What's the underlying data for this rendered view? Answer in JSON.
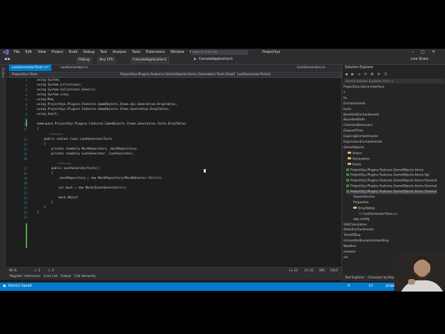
{
  "menu": [
    "File",
    "Edit",
    "View",
    "Project",
    "Build",
    "Debug",
    "Test",
    "Analyze",
    "Tools",
    "Extensions",
    "Window",
    "Help"
  ],
  "search_placeholder": "Search (Ctrl+Q)",
  "solution_name": "ProjectXyz",
  "toolbar": {
    "config": "Debug",
    "platform": "Any CPU",
    "startup": "ConsoleApplication1",
    "run": "ConsoleApplication1",
    "live_share": "Live Share"
  },
  "left_strip_label": "Toolbox",
  "tabs": [
    {
      "label": "LootGeneratorTests.cs*",
      "active": true
    },
    {
      "label": "LootGenerator.cs",
      "active": false
    },
    {
      "label": "ILootGenerator.cs",
      "active": false
    }
  ],
  "navbar": {
    "project": "ProjectXyz.Tests",
    "class": "ProjectXyz.Plugins.Features.GameObjects.Items.Generation.Tests.DropTables",
    "member": "LootGeneratorTests()"
  },
  "code_lines": [
    {
      "n": "1",
      "t": "using System;"
    },
    {
      "n": "2",
      "t": "using System.Collections;"
    },
    {
      "n": "3",
      "t": "using System.Collections.Generic;"
    },
    {
      "n": "4",
      "t": "using System.Linq;"
    },
    {
      "n": "5",
      "t": "using Moq;"
    },
    {
      "n": "6",
      "t": "using ProjectXyz.Plugins.Features.GameObjects.Items.Api.Generation.DropTables;"
    },
    {
      "n": "7",
      "t": "using ProjectXyz.Plugins.Features.GameObjects.Items.Generation.DropTables;"
    },
    {
      "n": "8",
      "t": "using Xunit;"
    },
    {
      "n": "9",
      "t": ""
    },
    {
      "n": "10",
      "t": "namespace ProjectXyz.Plugins.Features.GameObjects.Items.Generation.Tests.DropTables"
    },
    {
      "n": "11",
      "t": "{"
    },
    {
      "n": "12",
      "t": "    public sealed class LootGeneratorTests"
    },
    {
      "n": "13",
      "t": "    {"
    },
    {
      "n": "14",
      "t": "        private readonly MockRepository _mockRepository;"
    },
    {
      "n": "15",
      "t": "        private readonly LootGenerator _lootGenerator;"
    },
    {
      "n": "16",
      "t": ""
    },
    {
      "n": "17",
      "t": "        public LootGeneratorTests()"
    },
    {
      "n": "18",
      "t": "        {"
    },
    {
      "n": "19",
      "t": "            _mockRepository = new MockRepository(MockBehavior.Strict);"
    },
    {
      "n": "20",
      "t": ""
    },
    {
      "n": "21",
      "t": "            var mock = new Mock<ILootGenerator>();"
    },
    {
      "n": "22",
      "t": ""
    },
    {
      "n": "23",
      "t": "            mock.Object"
    },
    {
      "n": "24",
      "t": "        }"
    },
    {
      "n": "25",
      "t": "    }"
    },
    {
      "n": "26",
      "t": "}"
    },
    {
      "n": "27",
      "t": ""
    }
  ],
  "hints": {
    "class_refs": "0 references",
    "ctor_refs": "0 references"
  },
  "editor_status": {
    "zoom": "99 %",
    "errors": "2",
    "warnings": "0",
    "ln": "Ln 23",
    "ch": "Ch 25",
    "spc": "SPC",
    "crlf": "CRLF"
  },
  "bottom_tabs": [
    "'Register' references",
    "Error List",
    "Output",
    "Call Hierarchy"
  ],
  "statusbar": {
    "message": "Item(s) Saved",
    "up": "0",
    "changes": "13",
    "branch": "proje"
  },
  "solution_explorer": {
    "title": "Solution Explorer",
    "search": "Search Solution Explorer (Ctrl+;)",
    "items": [
      {
        "label": "ProjectXyz.Game.Interface",
        "kind": "text"
      },
      {
        "label": "s",
        "kind": "text"
      },
      {
        "label": "ta",
        "kind": "text"
      },
      {
        "label": "Enchantments",
        "kind": "text"
      },
      {
        "label": "tures",
        "kind": "text"
      },
      {
        "label": "BaseStatEnchantments",
        "kind": "text"
      },
      {
        "label": "BoundedStats",
        "kind": "text"
      },
      {
        "label": "CommonBehaviors",
        "kind": "text"
      },
      {
        "label": "ElapsedTime",
        "kind": "text"
      },
      {
        "label": "ExpiringEnchantments",
        "kind": "text"
      },
      {
        "label": "ExpressionEnchantments",
        "kind": "text"
      },
      {
        "label": "GameObjects",
        "kind": "text"
      },
      {
        "label": "Actors",
        "kind": "folder"
      },
      {
        "label": "Generation",
        "kind": "folder"
      },
      {
        "label": "Items",
        "kind": "folder"
      },
      {
        "label": "ProjectXyz.Plugins.Features.GameObjects.Items",
        "kind": "proj"
      },
      {
        "label": "ProjectXyz.Plugins.Features.GameObjects.Items.Api",
        "kind": "proj"
      },
      {
        "label": "ProjectXyz.Plugins.Features.GameObjects.Items.Generat",
        "kind": "proj"
      },
      {
        "label": "ProjectXyz.Plugins.Features.GameObjects.Items.Generat",
        "kind": "proj"
      },
      {
        "label": "ProjectXyz.Plugins.Features.GameObjects.Items.Generat",
        "kind": "proj"
      },
      {
        "label": "Dependencies",
        "kind": "sub"
      },
      {
        "label": "Properties",
        "kind": "sub"
      },
      {
        "label": "DropTables",
        "kind": "subfolder"
      },
      {
        "label": "LootGeneratorTests.cs",
        "kind": "file"
      },
      {
        "label": "app.config",
        "kind": "sub"
      },
      {
        "label": "StatCalculation",
        "kind": "text"
      },
      {
        "label": "StateEnchantments",
        "kind": "text"
      },
      {
        "label": "TimeOfDay",
        "kind": "text"
      },
      {
        "label": "UnhandledExceptionHandling",
        "kind": "text"
      },
      {
        "label": "Weather",
        "kind": "text"
      },
      {
        "label": "mework",
        "kind": "text"
      },
      {
        "label": "ols",
        "kind": "text"
      }
    ],
    "bottom_tabs": [
      "Test Explorer",
      "Conveyor by Keyoti"
    ]
  }
}
